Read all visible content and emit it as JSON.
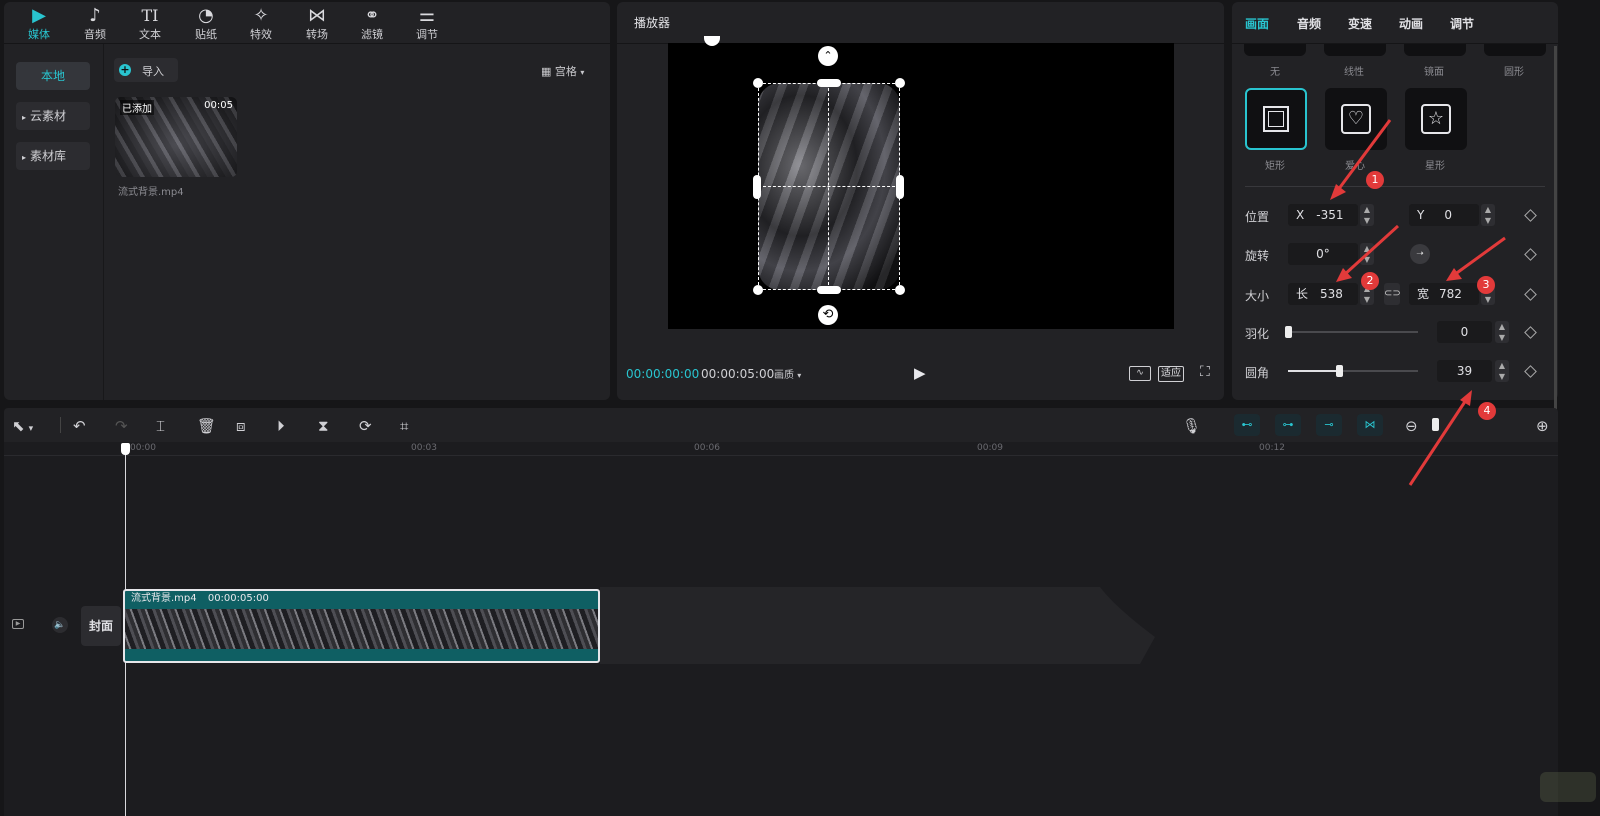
{
  "media_panel": {
    "tabs": [
      {
        "label": "媒体",
        "icon": "media-icon",
        "glyph": "▶"
      },
      {
        "label": "音频",
        "icon": "audio-icon",
        "glyph": "♪"
      },
      {
        "label": "文本",
        "icon": "text-icon",
        "glyph": "TI"
      },
      {
        "label": "贴纸",
        "icon": "sticker-icon",
        "glyph": "◔"
      },
      {
        "label": "特效",
        "icon": "effects-icon",
        "glyph": "✧"
      },
      {
        "label": "转场",
        "icon": "transition-icon",
        "glyph": "⋈"
      },
      {
        "label": "滤镜",
        "icon": "filter-icon",
        "glyph": "⚭"
      },
      {
        "label": "调节",
        "icon": "adjust-icon",
        "glyph": "⚌"
      }
    ],
    "sidebar": {
      "local": "本地",
      "cloud": "云素材",
      "library": "素材库"
    },
    "import_label": "导入",
    "view_mode": "宫格",
    "clip": {
      "badge": "已添加",
      "duration": "00:05",
      "filename": "流式背景.mp4"
    }
  },
  "player": {
    "title": "播放器",
    "current_time": "00:00:00:00",
    "total_time": "00:00:05:00",
    "quality": "画质",
    "ratio_label": "适应"
  },
  "props": {
    "tabs": [
      "画面",
      "音频",
      "变速",
      "动画",
      "调节"
    ],
    "mask_row1": [
      "无",
      "线性",
      "镜面",
      "圆形"
    ],
    "mask_row2": [
      "矩形",
      "爱心",
      "星形"
    ],
    "position": {
      "label": "位置",
      "x_label": "X",
      "x": "-351",
      "y_label": "Y",
      "y": "0"
    },
    "rotation": {
      "label": "旋转",
      "value": "0°"
    },
    "size": {
      "label": "大小",
      "w_label": "长",
      "w": "538",
      "h_label": "宽",
      "h": "782"
    },
    "feather": {
      "label": "羽化",
      "value": "0",
      "level": 0
    },
    "corner": {
      "label": "圆角",
      "value": "39",
      "level": 0.39
    }
  },
  "timeline": {
    "ticks": [
      "00:00",
      "00:03",
      "00:06",
      "00:09",
      "00:12"
    ],
    "track_cover": "封面",
    "clip_name": "流式背景.mp4",
    "clip_duration": "00:00:05:00"
  },
  "annotations": [
    "1",
    "2",
    "3",
    "4"
  ],
  "colors": {
    "accent": "#29c4cf",
    "annotation": "#e23a3a",
    "clip": "#0f5f63"
  }
}
